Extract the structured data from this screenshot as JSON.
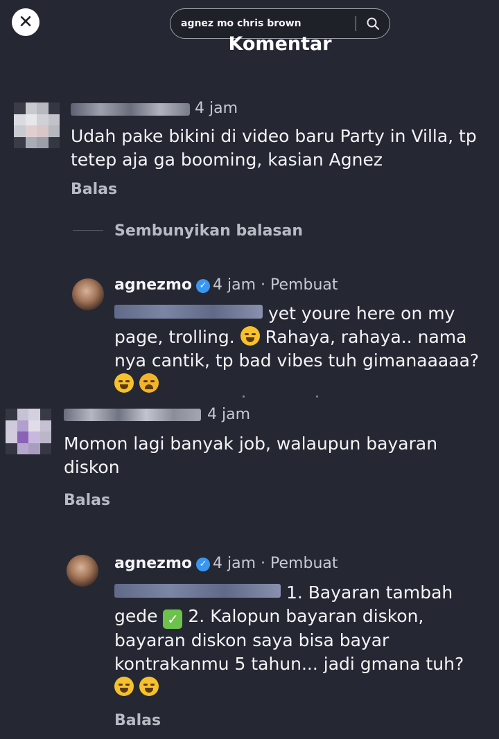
{
  "header": {
    "search_query": "agnez mo chris brown",
    "title": "Komentar",
    "close_icon": "close-icon",
    "search_icon": "search-icon"
  },
  "comments": [
    {
      "time": "4 jam",
      "text": "Udah pake bikini di video baru Party in Villa, tp tetep aja ga booming, kasian  Agnez",
      "reply_label": "Balas",
      "hide_replies_label": "Sembunyikan balasan",
      "reply": {
        "username": "agnezmo",
        "meta": "4 jam · Pembuat",
        "text_1": "yet youre here on my",
        "text_2": "page, trolling.",
        "text_3": "Rahaya, rahaya.. nama",
        "text_4": "nya cantik, tp bad vibes tuh gimanaaaaa?"
      }
    },
    {
      "time": "4 jam",
      "text": "Momon lagi banyak job, walaupun bayaran diskon",
      "reply_label": "Balas",
      "reply": {
        "username": "agnezmo",
        "meta": "4 jam · Pembuat",
        "text_1": "1. Bayaran tambah",
        "text_2": "gede",
        "text_3": "2. Kalopun bayaran diskon,",
        "text_4": "bayaran diskon saya bisa bayar",
        "text_5": "kontrakanmu 5 tahun... jadi gmana tuh?",
        "reply_label": "Balas"
      }
    }
  ],
  "colors": {
    "background": "#252833",
    "text": "#f4f4f6",
    "muted": "#b9bbc4",
    "verified": "#3897f0"
  }
}
